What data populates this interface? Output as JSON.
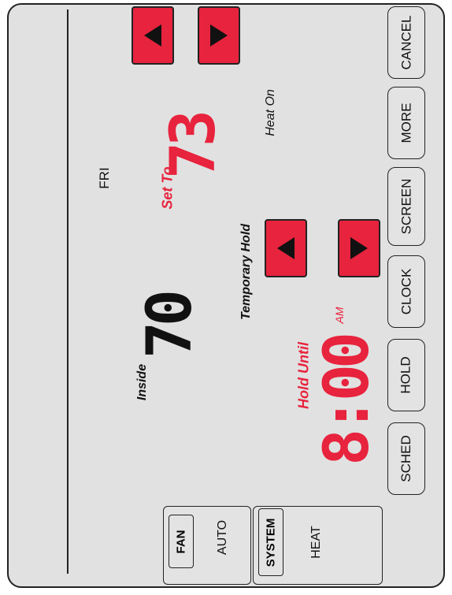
{
  "day": "FRI",
  "setpoint": {
    "label": "Set To",
    "value": "73"
  },
  "heat_status": "Heat On",
  "inside": {
    "label": "Inside",
    "value": "70"
  },
  "hold": {
    "mode": "Temporary Hold",
    "until_label": "Hold Until",
    "time": "8:00",
    "ampm": "AM"
  },
  "buttons": {
    "sched": "SCHED",
    "hold": "HOLD",
    "clock": "CLOCK",
    "screen": "SCREEN",
    "more": "MORE",
    "cancel": "CANCEL"
  },
  "fan": {
    "label": "FAN",
    "value": "AUTO"
  },
  "system": {
    "label": "SYSTEM",
    "value": "HEAT"
  },
  "colors": {
    "accent": "#e8233d",
    "background": "#e1e1e1",
    "frame": "#222222"
  },
  "icons": {
    "setpoint_arrows": [
      "arrow-left-icon",
      "arrow-right-icon"
    ],
    "hold_arrows": [
      "arrow-left-icon",
      "arrow-right-icon"
    ]
  }
}
